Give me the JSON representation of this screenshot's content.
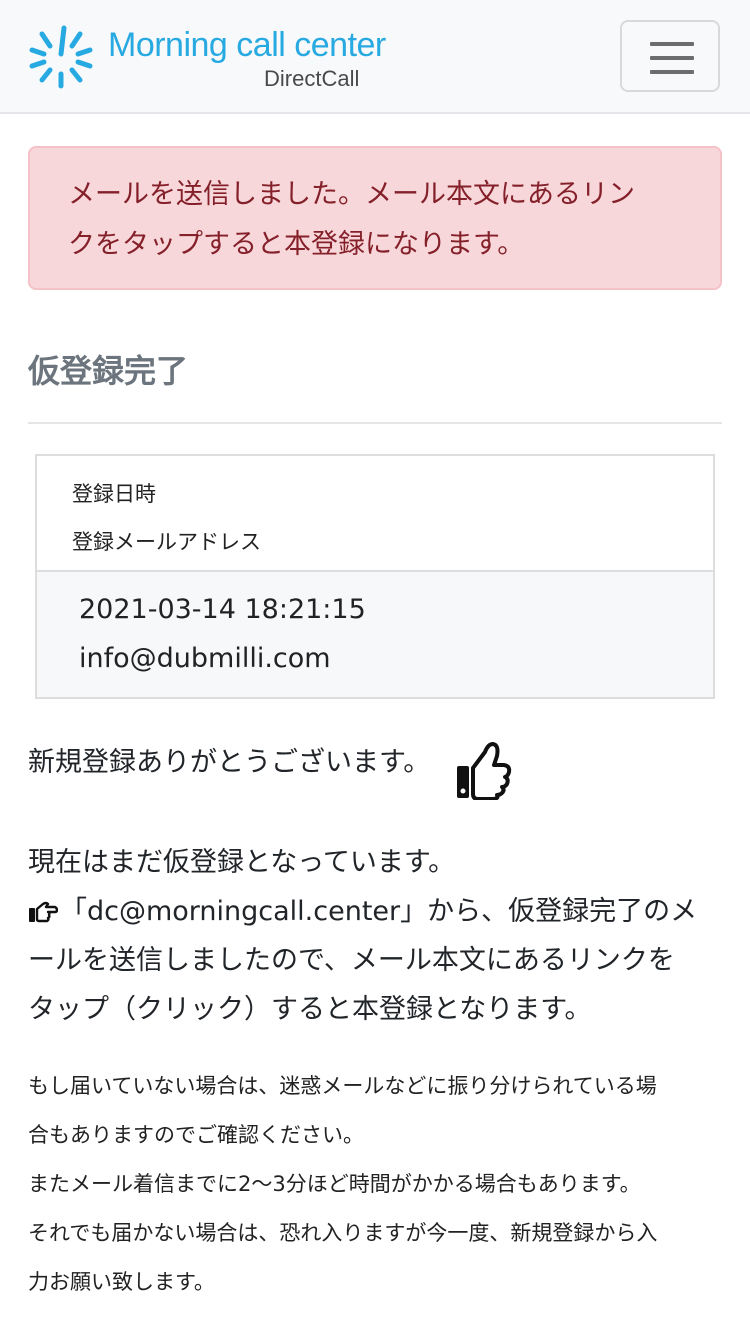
{
  "header": {
    "logo_title": "Morning call center",
    "logo_sub": "DirectCall",
    "menu_icon": "hamburger-menu-icon",
    "brand_color": "#27a9e1"
  },
  "alert": {
    "line1": "メールを送信しました。メール本文にあるリン",
    "line2": "クをタップすると本登録になります。"
  },
  "page_title": "仮登録完了",
  "info": {
    "date_label": "登録日時",
    "email_label": "登録メールアドレス",
    "date_value": "2021-03-14 18:21:15",
    "email_value": "info@dubmilli.com"
  },
  "thanks": {
    "text": "新規登録ありがとうございます。",
    "icon": "thumbs-up-icon"
  },
  "message": {
    "line1": "現在はまだ仮登録となっています。",
    "line2": "「dc@morningcall.center」から、仮登録完了のメ",
    "line3": "ールを送信しましたので、メール本文にあるリンクを",
    "line4": "タップ（クリック）すると本登録となります。",
    "icon": "hand-point-right-icon"
  },
  "note": {
    "line1": "もし届いていない場合は、迷惑メールなどに振り分けられている場",
    "line2": "合もありますのでご確認ください。",
    "line3": "またメール着信までに2〜3分ほど時間がかかる場合もあります。",
    "line4": "それでも届かない場合は、恐れ入りますが今一度、新規登録から入",
    "line5": "力お願い致します。"
  }
}
